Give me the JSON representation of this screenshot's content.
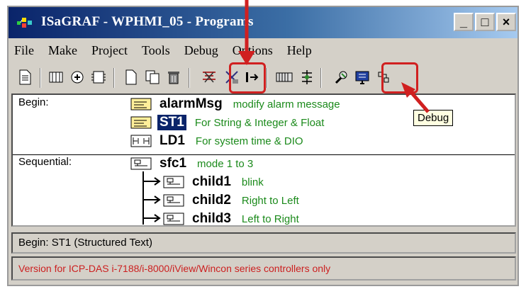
{
  "window": {
    "title": "ISaGRAF - WPHMI_05 - Programs",
    "buttons": {
      "minimize": "_",
      "maximize": "□",
      "close": "×"
    }
  },
  "menu": [
    "File",
    "Make",
    "Project",
    "Tools",
    "Debug",
    "Options",
    "Help"
  ],
  "toolbar": {
    "icons": [
      "edit-doc-icon",
      "dictionary-icon",
      "variables-icon",
      "io-connection-icon",
      "new-program-icon",
      "copy-program-icon",
      "delete-program-icon",
      "verify-icon",
      "make-icon",
      "link-icon",
      "simulate-icon",
      "download-icon",
      "debug-icon",
      "monitor-icon",
      "options-icon"
    ],
    "tooltip": "Debug"
  },
  "sections": [
    {
      "label": "Begin:",
      "programs": [
        {
          "name": "alarmMsg",
          "desc": "modify alarm message",
          "type": "ST",
          "selected": false
        },
        {
          "name": "ST1",
          "desc": "For String & Integer & Float",
          "type": "ST",
          "selected": true
        },
        {
          "name": "LD1",
          "desc": "For system time & DIO",
          "type": "LD",
          "selected": false
        }
      ]
    },
    {
      "label": "Sequential:",
      "programs": [
        {
          "name": "sfc1",
          "desc": "mode 1 to 3",
          "type": "SFC",
          "selected": false
        },
        {
          "name": "child1",
          "desc": "blink",
          "type": "SFC-child",
          "selected": false
        },
        {
          "name": "child2",
          "desc": "Right to Left",
          "type": "SFC-child",
          "selected": false
        },
        {
          "name": "child3",
          "desc": "Left to Right",
          "type": "SFC-child",
          "selected": false
        }
      ]
    }
  ],
  "status": {
    "line1": "Begin:  ST1   (Structured Text)",
    "line2": "Version for ICP-DAS i-7188/i-8000/iView/Wincon series controllers only"
  },
  "colors": {
    "annotation": "#d02020",
    "description": "#1b8a1b",
    "selection": "#0a246a"
  }
}
